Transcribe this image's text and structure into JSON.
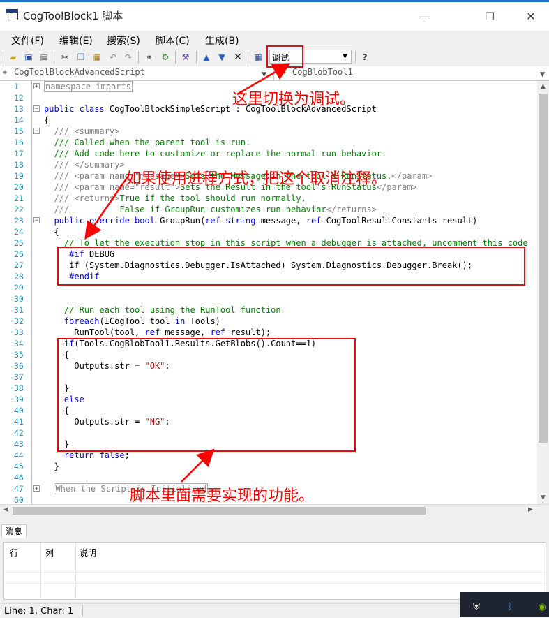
{
  "window": {
    "title": "CogToolBlock1 脚本",
    "min": "—",
    "max": "☐",
    "close": "✕"
  },
  "menu": [
    "文件(F)",
    "编辑(E)",
    "搜索(S)",
    "脚本(C)",
    "生成(B)"
  ],
  "toolbar": {
    "icons": [
      "open-icon",
      "save-icon",
      "print-icon",
      "cut-icon",
      "copy-icon",
      "paste-icon",
      "undo-icon",
      "redo-icon",
      "find-icon",
      "replace-icon",
      "build-icon",
      "up-icon",
      "down-icon",
      "delete-icon",
      "calculator-icon",
      "help-icon"
    ],
    "mode_value": "调试"
  },
  "selectors": {
    "class": "CogToolBlockAdvancedScript",
    "member": "CogBlobTool1"
  },
  "code": [
    {
      "n": "1",
      "fold": "+",
      "parts": [
        [
          "collapsed",
          "namespace imports"
        ]
      ]
    },
    {
      "n": "12",
      "parts": []
    },
    {
      "n": "13",
      "fold": "-",
      "parts": [
        [
          "k",
          "public class "
        ],
        [
          "",
          "CogToolBlockSimpleScript : CogToolBlockAdvancedScript"
        ]
      ]
    },
    {
      "n": "14",
      "parts": [
        [
          "",
          "{"
        ]
      ]
    },
    {
      "n": "15",
      "fold": "-",
      "parts": [
        [
          "cg",
          "  /// <summary>"
        ]
      ]
    },
    {
      "n": "16",
      "parts": [
        [
          "c",
          "  /// Called when the parent tool is run."
        ]
      ]
    },
    {
      "n": "17",
      "parts": [
        [
          "c",
          "  /// Add code here to customize or replace the normal run behavior."
        ]
      ]
    },
    {
      "n": "18",
      "parts": [
        [
          "cg",
          "  /// </summary>"
        ]
      ]
    },
    {
      "n": "19",
      "parts": [
        [
          "cg",
          "  /// <param name=\"message\">"
        ],
        [
          "c",
          "Sets the Message in the tool's RunStatus."
        ],
        [
          "cg",
          "</param>"
        ]
      ]
    },
    {
      "n": "20",
      "parts": [
        [
          "cg",
          "  /// <param name=\"result\">"
        ],
        [
          "c",
          "Sets the Result in the tool's RunStatus"
        ],
        [
          "cg",
          "</param>"
        ]
      ]
    },
    {
      "n": "21",
      "parts": [
        [
          "cg",
          "  /// <returns>"
        ],
        [
          "c",
          "True if the tool should run normally,"
        ]
      ]
    },
    {
      "n": "22",
      "parts": [
        [
          "cg",
          "  ///          "
        ],
        [
          "c",
          "False if GroupRun customizes run behavior"
        ],
        [
          "cg",
          "</returns>"
        ]
      ]
    },
    {
      "n": "23",
      "fold": "-",
      "parts": [
        [
          "k",
          "  public override bool "
        ],
        [
          "",
          "GroupRun("
        ],
        [
          "k",
          "ref string "
        ],
        [
          "",
          "message, "
        ],
        [
          "k",
          "ref "
        ],
        [
          "",
          "CogToolResultConstants result)"
        ]
      ]
    },
    {
      "n": "24",
      "parts": [
        [
          "",
          "  {"
        ]
      ]
    },
    {
      "n": "25",
      "parts": [
        [
          "c",
          "    // To let the execution stop in this script when a debugger is attached, uncomment this code"
        ]
      ]
    },
    {
      "n": "26",
      "parts": [
        [
          "pp",
          "     #if "
        ],
        [
          "",
          "DEBUG"
        ]
      ]
    },
    {
      "n": "27",
      "parts": [
        [
          "",
          "     if (System.Diagnostics.Debugger.IsAttached) System.Diagnostics.Debugger.Break();"
        ]
      ]
    },
    {
      "n": "28",
      "parts": [
        [
          "pp",
          "     #endif"
        ]
      ]
    },
    {
      "n": "29",
      "parts": []
    },
    {
      "n": "30",
      "parts": []
    },
    {
      "n": "31",
      "parts": [
        [
          "c",
          "    // Run each tool using the RunTool function"
        ]
      ]
    },
    {
      "n": "32",
      "parts": [
        [
          "k",
          "    foreach"
        ],
        [
          "",
          "(ICogTool tool "
        ],
        [
          "k",
          "in "
        ],
        [
          "",
          "Tools)"
        ]
      ]
    },
    {
      "n": "33",
      "parts": [
        [
          "",
          "      RunTool(tool, "
        ],
        [
          "k",
          "ref "
        ],
        [
          "",
          "message, "
        ],
        [
          "k",
          "ref "
        ],
        [
          "",
          "result);"
        ]
      ]
    },
    {
      "n": "34",
      "parts": [
        [
          "k",
          "    if"
        ],
        [
          "",
          "(Tools.CogBlobTool1.Results.GetBlobs().Count==1)"
        ]
      ]
    },
    {
      "n": "35",
      "parts": [
        [
          "",
          "    {"
        ]
      ]
    },
    {
      "n": "36",
      "parts": [
        [
          "",
          "      Outputs.str = "
        ],
        [
          "s",
          "\"OK\""
        ],
        [
          "",
          ";"
        ]
      ]
    },
    {
      "n": "37",
      "parts": []
    },
    {
      "n": "38",
      "parts": [
        [
          "",
          "    }"
        ]
      ]
    },
    {
      "n": "39",
      "parts": [
        [
          "k",
          "    else"
        ]
      ]
    },
    {
      "n": "40",
      "parts": [
        [
          "",
          "    {"
        ]
      ]
    },
    {
      "n": "41",
      "parts": [
        [
          "",
          "      Outputs.str = "
        ],
        [
          "s",
          "\"NG\""
        ],
        [
          "",
          ";"
        ]
      ]
    },
    {
      "n": "42",
      "parts": []
    },
    {
      "n": "43",
      "parts": [
        [
          "",
          "    }"
        ]
      ]
    },
    {
      "n": "44",
      "parts": [
        [
          "k",
          "    return false"
        ],
        [
          "",
          ";"
        ]
      ]
    },
    {
      "n": "45",
      "parts": [
        [
          "",
          "  }"
        ]
      ]
    },
    {
      "n": "46",
      "parts": []
    },
    {
      "n": "47",
      "fold": "+",
      "parts": [
        [
          "",
          "  "
        ],
        [
          "collapsed",
          "When the Script is Initialized"
        ]
      ]
    },
    {
      "n": "60",
      "parts": []
    }
  ],
  "messages": {
    "tab": "消息",
    "columns": [
      "行",
      "列",
      "说明"
    ]
  },
  "status": "Line: 1, Char: 1",
  "tray": [
    "shield-icon",
    "bluetooth-icon",
    "nvidia-icon"
  ],
  "annotations": {
    "switch_debug": "这里切换为调试。",
    "process_mode": "如果使用进程方式，把这个取消注释。",
    "function": "脚本里面需要实现的功能。"
  },
  "colors": {
    "annotation": "#ff0000",
    "keyword": "#0000ff",
    "comment": "#008000",
    "string": "#a31515"
  }
}
